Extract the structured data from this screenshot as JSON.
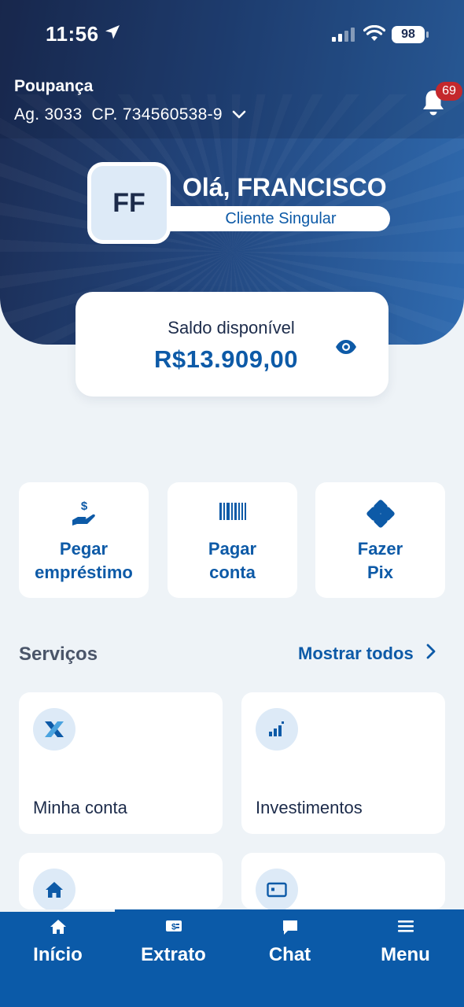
{
  "status_bar": {
    "time": "11:56",
    "battery": "98"
  },
  "account": {
    "type": "Poupança",
    "agency": "Ag. 3033",
    "number": "CP. 734560538-9",
    "notifications": "69"
  },
  "profile": {
    "initials": "FF",
    "greeting": "Olá, FRANCISCO",
    "tier": "Cliente Singular"
  },
  "balance": {
    "label": "Saldo disponível",
    "value": "R$13.909,00"
  },
  "quick_actions": [
    {
      "label": "Pegar\nempréstimo",
      "icon": "loan-hand-icon"
    },
    {
      "label": "Pagar\nconta",
      "icon": "barcode-icon"
    },
    {
      "label": "Fazer\nPix",
      "icon": "pix-icon"
    }
  ],
  "services": {
    "title": "Serviços",
    "show_all": "Mostrar todos",
    "items": [
      {
        "label": "Minha conta",
        "icon": "caixa-logo-icon"
      },
      {
        "label": "Investimentos",
        "icon": "bar-chart-icon"
      },
      {
        "label": "",
        "icon": "house-icon"
      },
      {
        "label": "",
        "icon": "card-icon"
      }
    ]
  },
  "tabbar": {
    "items": [
      {
        "label": "Início",
        "icon": "home-icon"
      },
      {
        "label": "Extrato",
        "icon": "statement-icon"
      },
      {
        "label": "Chat",
        "icon": "chat-icon"
      },
      {
        "label": "Menu",
        "icon": "menu-icon"
      }
    ]
  },
  "colors": {
    "brand_blue": "#0d5aa7",
    "tabbar": "#0b5aa8",
    "hero_dark": "#1b2b52",
    "background": "#eef3f7",
    "badge": "#c4282c"
  }
}
